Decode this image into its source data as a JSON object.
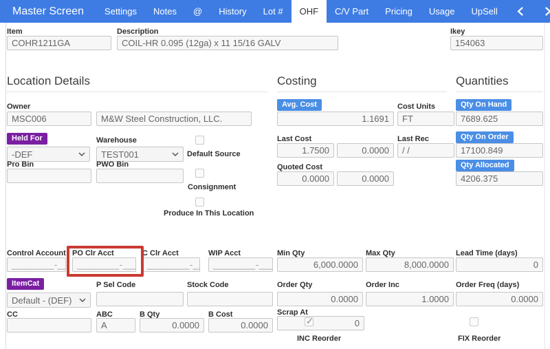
{
  "titlebar": {
    "title": "Master Screen",
    "tabs": [
      {
        "label": "Settings",
        "active": false
      },
      {
        "label": "Notes",
        "active": false
      },
      {
        "label": "@",
        "active": false
      },
      {
        "label": "History",
        "active": false
      },
      {
        "label": "Lot #",
        "active": false
      },
      {
        "label": "OHF",
        "active": true
      },
      {
        "label": "C/V Part",
        "active": false
      },
      {
        "label": "Pricing",
        "active": false
      },
      {
        "label": "Usage",
        "active": false
      },
      {
        "label": "UpSell",
        "active": false
      }
    ]
  },
  "header": {
    "item": {
      "label": "Item",
      "value": "COHR1211GA"
    },
    "description": {
      "label": "Description",
      "value": "COIL-HR 0.095 (12ga) x 11 15/16 GALV"
    },
    "ikey": {
      "label": "Ikey",
      "value": "154063"
    }
  },
  "location": {
    "title": "Location Details",
    "owner": {
      "label": "Owner",
      "code": "MSC006",
      "name": "M&W Steel Construction, LLC."
    },
    "held_for": {
      "label": "Held For",
      "value": "-DEF"
    },
    "warehouse": {
      "label": "Warehouse",
      "value": "TEST001"
    },
    "default_source": {
      "label": "Default Source",
      "checked": false
    },
    "pro_bin": {
      "label": "Pro Bin",
      "value": ""
    },
    "pwo_bin": {
      "label": "PWO Bin",
      "value": ""
    },
    "consignment": {
      "label": "Consignment",
      "checked": false
    },
    "produce": {
      "label": "Produce In This Location",
      "checked": false
    }
  },
  "costing": {
    "title": "Costing",
    "avg_cost": {
      "label": "Avg. Cost",
      "value": "1.1691"
    },
    "cost_units": {
      "label": "Cost Units",
      "value": "FT"
    },
    "last_cost": {
      "label": "Last Cost",
      "value1": "1.7500",
      "value2": "0.0000"
    },
    "last_rec": {
      "label": "Last Rec",
      "value": "/ /"
    },
    "quoted_cost": {
      "label": "Quoted Cost",
      "value1": "0.0000",
      "value2": "0.0000"
    }
  },
  "quantities": {
    "title": "Quantities",
    "qty_on_hand": {
      "label": "Qty On Hand",
      "value": "7689.625"
    },
    "qty_on_order": {
      "label": "Qty On Order",
      "value": "17100.849"
    },
    "qty_allocated": {
      "label": "Qty Allocated",
      "value": "4206.375"
    }
  },
  "bottom": {
    "control_account": {
      "label": "Control Account",
      "value": "________-___"
    },
    "po_clr_acct": {
      "label": "PO Clr Acct",
      "value": "________-___"
    },
    "c_clr_acct": {
      "label": "C Clr Acct",
      "value": "________-___"
    },
    "wip_acct": {
      "label": "WIP Acct",
      "value": "________-___"
    },
    "min_qty": {
      "label": "Min Qty",
      "value": "6,000.0000"
    },
    "max_qty": {
      "label": "Max Qty",
      "value": "8,000.0000"
    },
    "lead_time": {
      "label": "Lead Time (days)",
      "value": "0"
    },
    "itemcat": {
      "label": "ItemCat",
      "value": "Default - (DEF)"
    },
    "p_sel_code": {
      "label": "P Sel Code",
      "value": ""
    },
    "stock_code": {
      "label": "Stock Code",
      "value": ""
    },
    "order_qty": {
      "label": "Order Qty",
      "value": "0.0000"
    },
    "order_inc": {
      "label": "Order Inc",
      "value": "1.0000"
    },
    "order_freq": {
      "label": "Order Freq (days)",
      "value": "0.0000"
    },
    "cc": {
      "label": "CC",
      "value": ""
    },
    "abc": {
      "label": "ABC",
      "value": "A"
    },
    "b_qty": {
      "label": "B Qty",
      "value": "0.0000"
    },
    "b_cost": {
      "label": "B Cost",
      "value": "0.0000"
    },
    "scrap_at": {
      "label": "Scrap At",
      "value": "0"
    },
    "inc_reorder": {
      "label": "INC Reorder",
      "checked": true
    },
    "fix_reorder": {
      "label": "FIX Reorder",
      "checked": false
    }
  },
  "colors": {
    "navbar_blue": "#3e7ce4",
    "badge_blue": "#4a8ee6",
    "badge_purple": "#7b1fa2",
    "highlight_red": "#c93b32"
  }
}
